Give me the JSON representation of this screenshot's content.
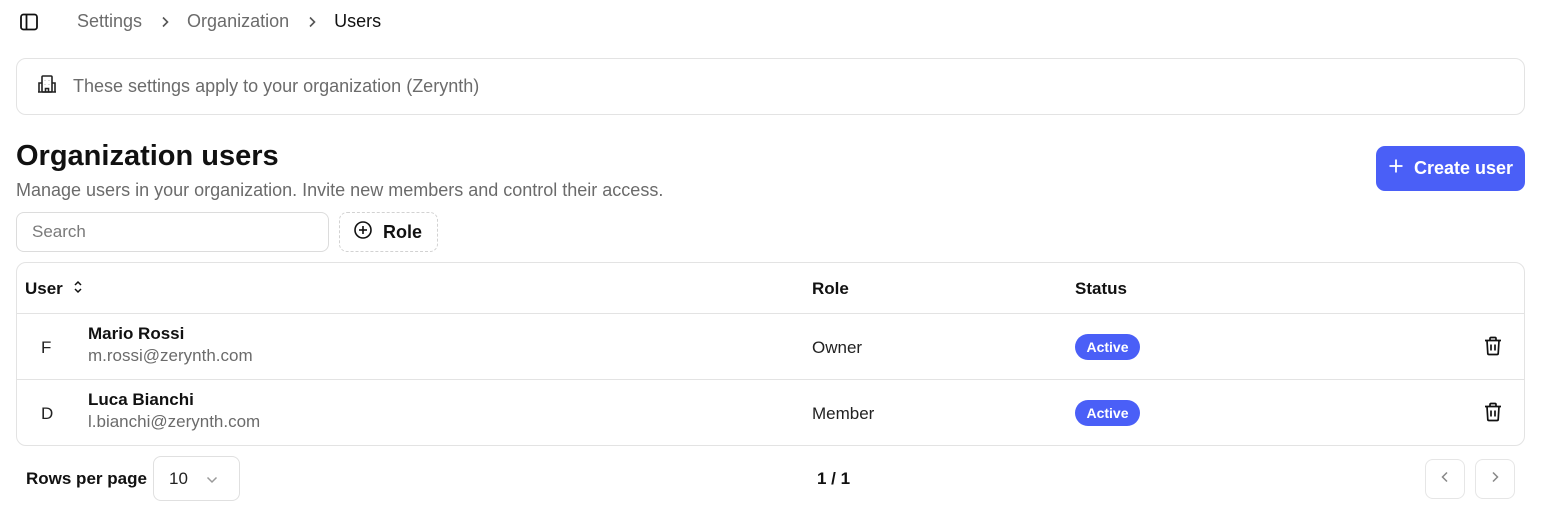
{
  "breadcrumb": {
    "items": [
      "Settings",
      "Organization",
      "Users"
    ]
  },
  "org_banner": {
    "text": "These settings apply to your organization (Zerynth)",
    "icon": "building-icon"
  },
  "header": {
    "title": "Organization users",
    "description": "Manage users in your organization. Invite new members and control their access.",
    "create_button_label": "Create user"
  },
  "filters": {
    "search_placeholder": "Search",
    "search_value": "",
    "role_filter_label": "Role"
  },
  "table": {
    "columns": {
      "user": "User",
      "role": "Role",
      "status": "Status"
    },
    "rows": [
      {
        "avatar": "F",
        "name": "Mario Rossi",
        "email": "m.rossi@zerynth.com",
        "role": "Owner",
        "status": "Active"
      },
      {
        "avatar": "D",
        "name": "Luca Bianchi",
        "email": "l.bianchi@zerynth.com",
        "role": "Member",
        "status": "Active"
      }
    ]
  },
  "pagination": {
    "rows_per_page_label": "Rows per page",
    "rows_per_page_value": "10",
    "page_indicator": "1 / 1"
  },
  "colors": {
    "accent": "#4a5ff7",
    "muted_text": "#6b6b6b",
    "border": "#e3e3e3"
  }
}
